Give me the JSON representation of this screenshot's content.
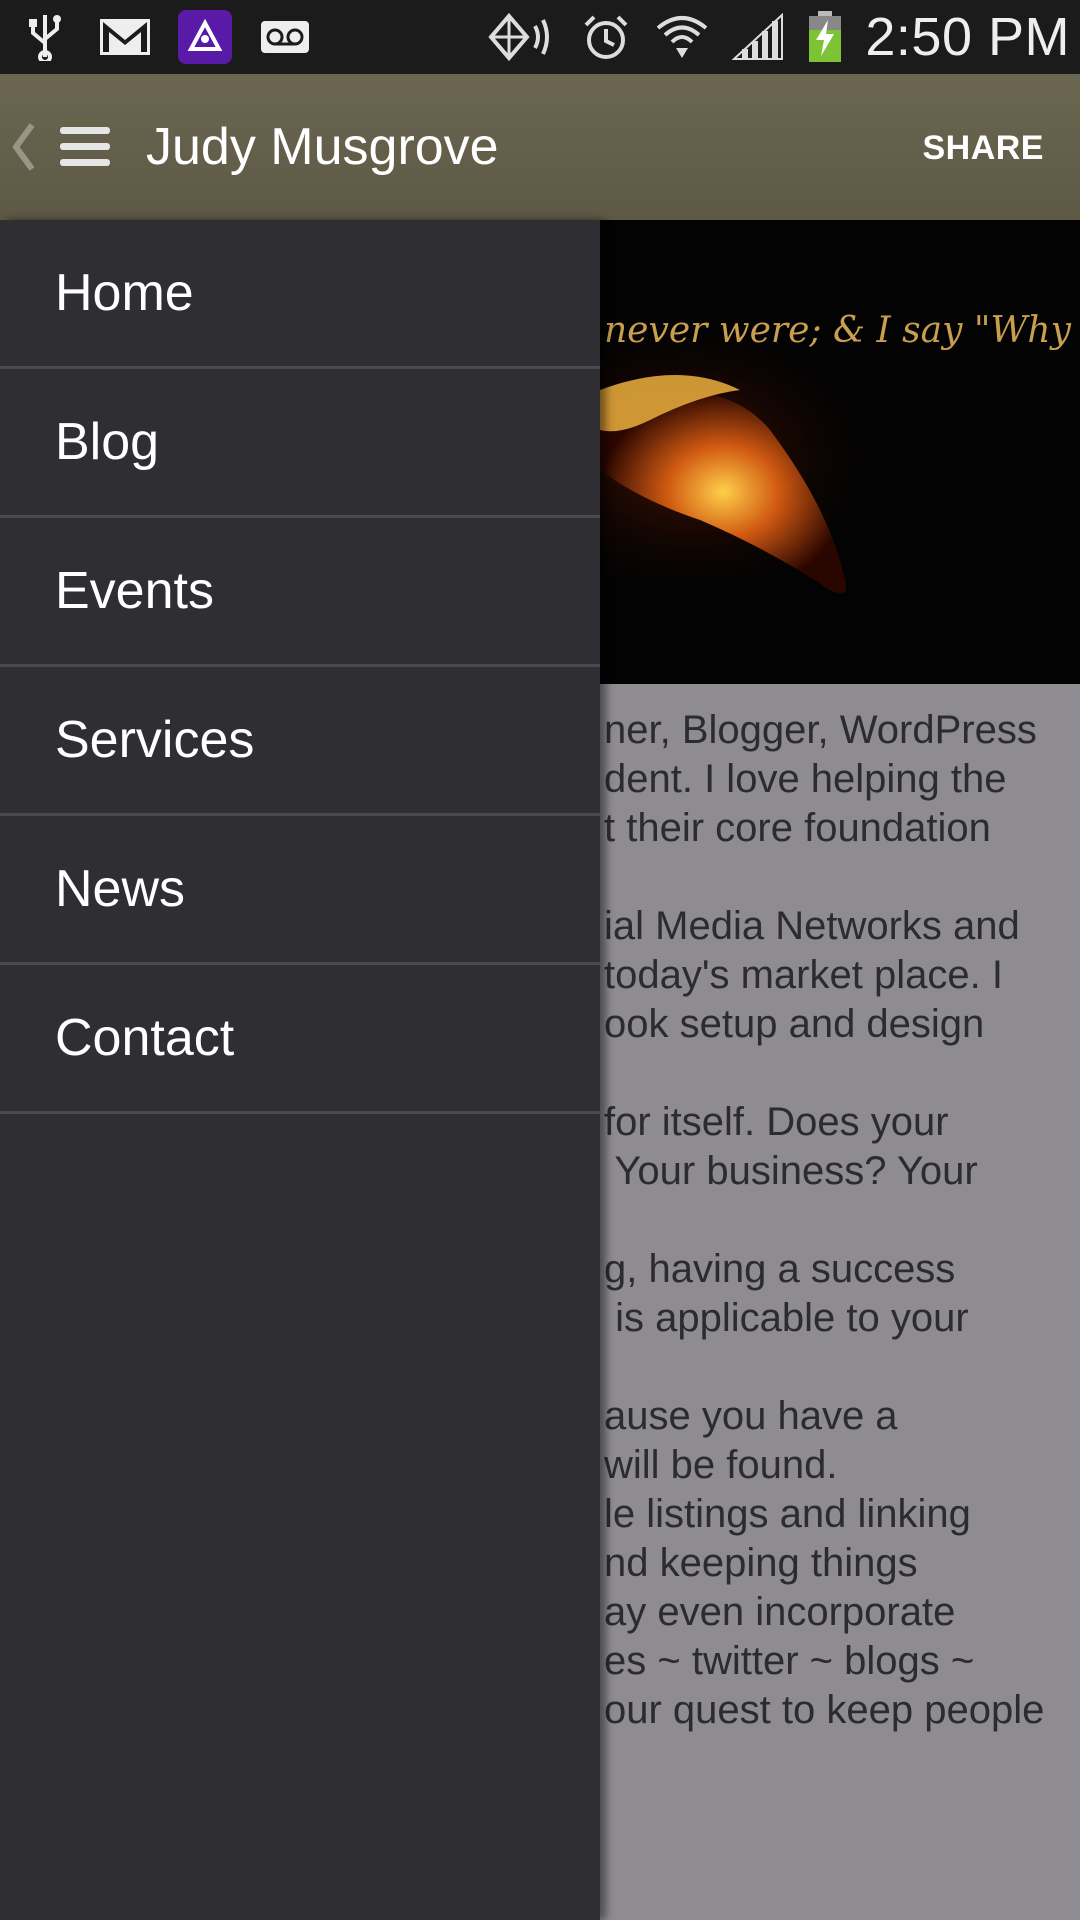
{
  "status_bar": {
    "left_icons": [
      "usb-icon",
      "gmail-icon",
      "app-triangle-icon",
      "voicemail-icon"
    ],
    "right_icons": [
      "nfc-vibrate-icon",
      "alarm-icon",
      "wifi-icon",
      "signal-icon",
      "battery-charging-icon"
    ],
    "time": "2:50 PM"
  },
  "action_bar": {
    "title": "Judy Musgrove",
    "share_label": "SHARE",
    "color": "#635f4a"
  },
  "drawer": {
    "items": [
      {
        "label": "Home"
      },
      {
        "label": "Blog"
      },
      {
        "label": "Events"
      },
      {
        "label": "Services"
      },
      {
        "label": "News"
      },
      {
        "label": "Contact"
      }
    ]
  },
  "content": {
    "banner_quote": "never were; & I say \"Why Not?\"",
    "lines": [
      "ner, Blogger, WordPress",
      "dent. I love helping the",
      "t their core foundation",
      "",
      "ial Media Networks and",
      "today's market place. I",
      "ook setup and design",
      "",
      "for itself. Does your",
      " Your business? Your",
      "",
      "g, having a success",
      " is applicable to your",
      "",
      "ause you have a",
      "will be found.",
      "le listings and linking",
      "nd keeping things",
      "ay even incorporate",
      "es ~ twitter ~ blogs ~",
      "our quest to keep people"
    ]
  }
}
